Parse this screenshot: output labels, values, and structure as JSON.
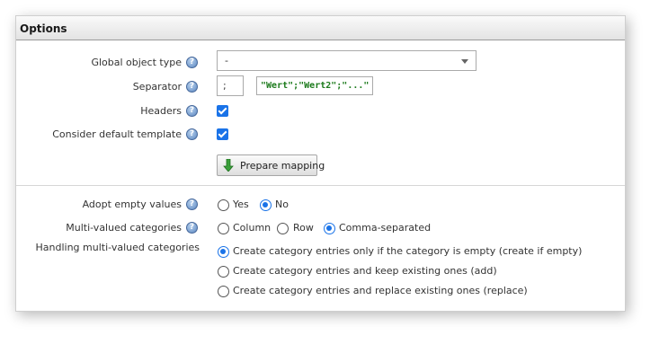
{
  "panel": {
    "title": "Options"
  },
  "form": {
    "global_object_type": {
      "label": "Global object type",
      "value": "-"
    },
    "separator": {
      "label": "Separator",
      "value": ";",
      "example": "\"Wert\";\"Wert2\";\"...\""
    },
    "headers": {
      "label": "Headers",
      "checked": true
    },
    "default_template": {
      "label": "Consider default template",
      "checked": true
    },
    "prepare_mapping": {
      "label": "Prepare mapping",
      "icon": "down-arrow-icon"
    },
    "adopt_empty": {
      "label": "Adopt empty values",
      "options": [
        "Yes",
        "No"
      ],
      "selected": "No"
    },
    "multi_valued": {
      "label": "Multi-valued categories",
      "options": [
        "Column",
        "Row",
        "Comma-separated"
      ],
      "selected": "Comma-separated"
    },
    "handling": {
      "label": "Handling multi-valued categories",
      "options": [
        "Create category entries only if the category is empty (create if empty)",
        "Create category entries and keep existing ones (add)",
        "Create category entries and replace existing ones (replace)"
      ],
      "selected": "Create category entries only if the category is empty (create if empty)"
    }
  },
  "help_icon": "help-icon",
  "colors": {
    "accent": "#1a73e8",
    "code_string": "#1b7a1b"
  }
}
